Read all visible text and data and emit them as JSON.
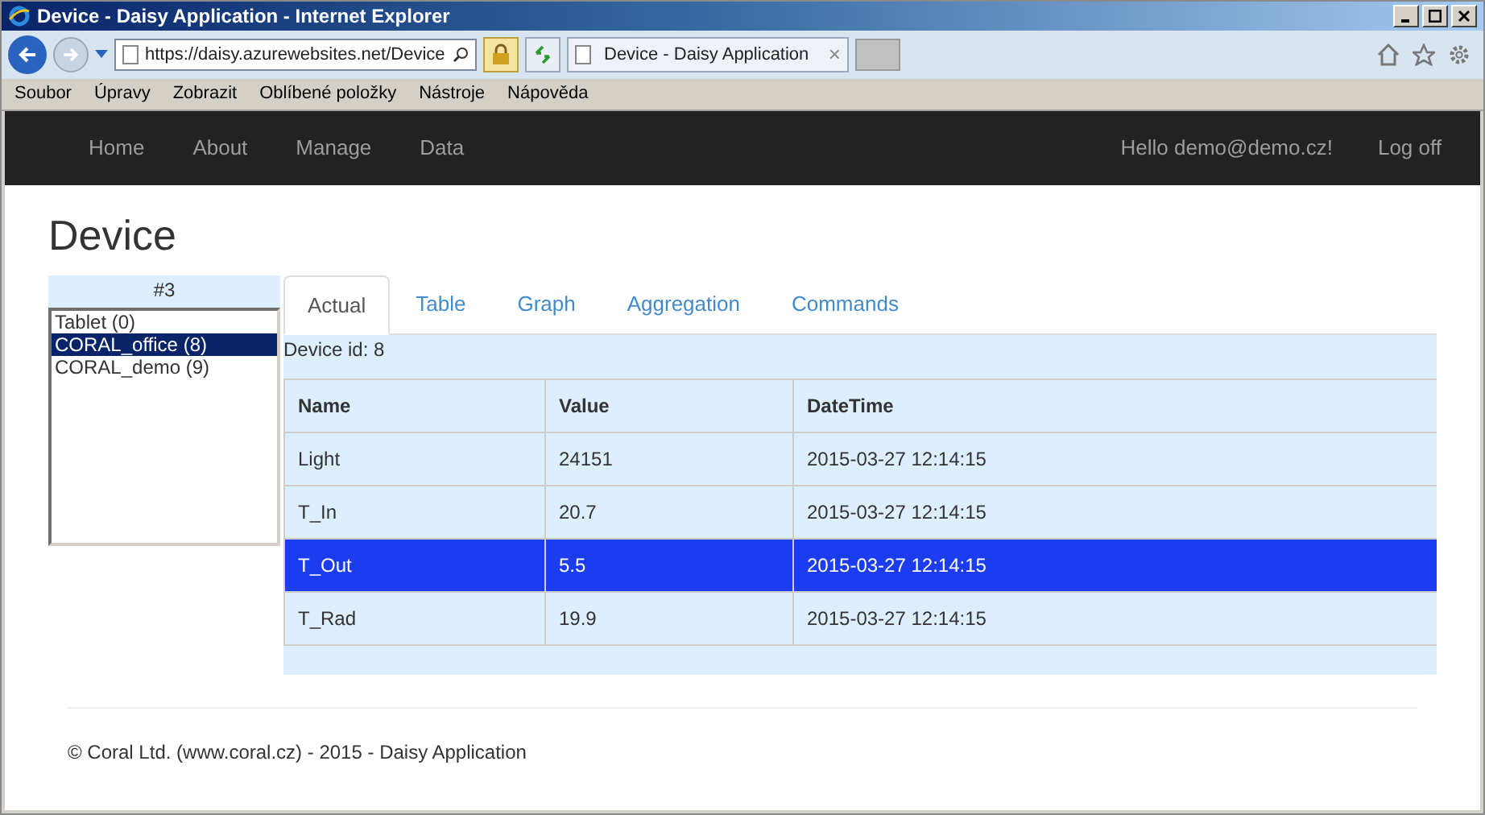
{
  "window": {
    "title": "Device - Daisy Application - Internet Explorer"
  },
  "browser": {
    "address": "https://daisy.azurewebsites.net/Device",
    "tab_title": "Device - Daisy Application",
    "tab_close": "×"
  },
  "menu": [
    "Soubor",
    "Úpravy",
    "Zobrazit",
    "Oblíbené položky",
    "Nástroje",
    "Nápověda"
  ],
  "nav": {
    "links": [
      "Home",
      "About",
      "Manage",
      "Data"
    ],
    "greeting": "Hello demo@demo.cz!",
    "logoff": "Log off"
  },
  "page": {
    "heading": "Device"
  },
  "device_list": {
    "header": "#3",
    "items": [
      {
        "label": "Tablet (0)",
        "selected": false
      },
      {
        "label": "CORAL_office (8)",
        "selected": true
      },
      {
        "label": "CORAL_demo (9)",
        "selected": false
      }
    ]
  },
  "tabs": [
    {
      "label": "Actual",
      "selected": true
    },
    {
      "label": "Table",
      "selected": false
    },
    {
      "label": "Graph",
      "selected": false
    },
    {
      "label": "Aggregation",
      "selected": false
    },
    {
      "label": "Commands",
      "selected": false
    }
  ],
  "device_id": "Device id: 8",
  "table": {
    "columns": [
      "Name",
      "Value",
      "DateTime"
    ],
    "rows": [
      {
        "cells": [
          "Light",
          "24151",
          "2015-03-27 12:14:15"
        ],
        "selected": false
      },
      {
        "cells": [
          "T_In",
          "20.7",
          "2015-03-27 12:14:15"
        ],
        "selected": false
      },
      {
        "cells": [
          "T_Out",
          "5.5",
          "2015-03-27 12:14:15"
        ],
        "selected": true
      },
      {
        "cells": [
          "T_Rad",
          "19.9",
          "2015-03-27 12:14:15"
        ],
        "selected": false
      }
    ]
  },
  "footer": "© Coral Ltd. (www.coral.cz) - 2015 - Daisy Application"
}
